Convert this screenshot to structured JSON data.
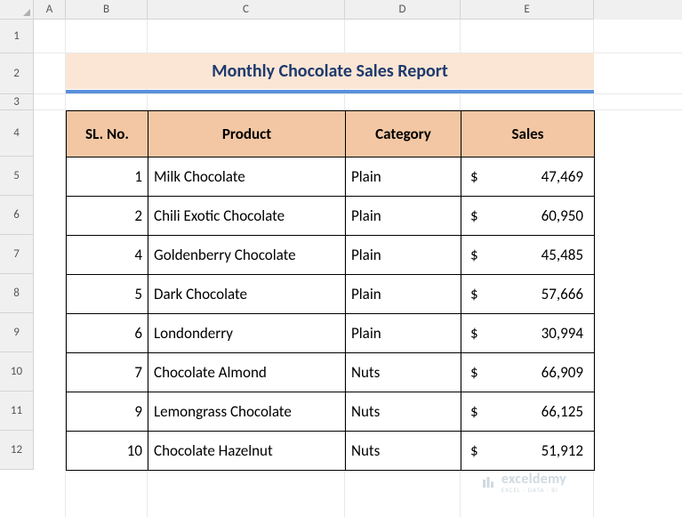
{
  "columns": {
    "A": "A",
    "B": "B",
    "C": "C",
    "D": "D",
    "E": "E"
  },
  "rows": {
    "r1": "1",
    "r2": "2",
    "r3": "3",
    "r4": "4",
    "r5": "5",
    "r6": "6",
    "r7": "7",
    "r8": "8",
    "r9": "9",
    "r10": "10",
    "r11": "11",
    "r12": "12"
  },
  "title": "Monthly Chocolate Sales Report",
  "headers": {
    "sl": "SL. No.",
    "product": "Product",
    "category": "Category",
    "sales": "Sales"
  },
  "currency": "$",
  "data": [
    {
      "sl": "1",
      "product": "Milk Chocolate",
      "category": "Plain",
      "sales": "47,469"
    },
    {
      "sl": "2",
      "product": "Chili Exotic Chocolate",
      "category": "Plain",
      "sales": "60,950"
    },
    {
      "sl": "4",
      "product": "Goldenberry Chocolate",
      "category": "Plain",
      "sales": "45,485"
    },
    {
      "sl": "5",
      "product": "Dark Chocolate",
      "category": "Plain",
      "sales": "57,666"
    },
    {
      "sl": "6",
      "product": "Londonderry",
      "category": "Plain",
      "sales": "30,994"
    },
    {
      "sl": "7",
      "product": "Chocolate Almond",
      "category": "Nuts",
      "sales": "66,909"
    },
    {
      "sl": "9",
      "product": "Lemongrass Chocolate",
      "category": "Nuts",
      "sales": "66,125"
    },
    {
      "sl": "10",
      "product": "Chocolate Hazelnut",
      "category": "Nuts",
      "sales": "51,912"
    }
  ],
  "watermark": {
    "name": "exceldemy",
    "tagline": "EXCEL · DATA · BI"
  }
}
